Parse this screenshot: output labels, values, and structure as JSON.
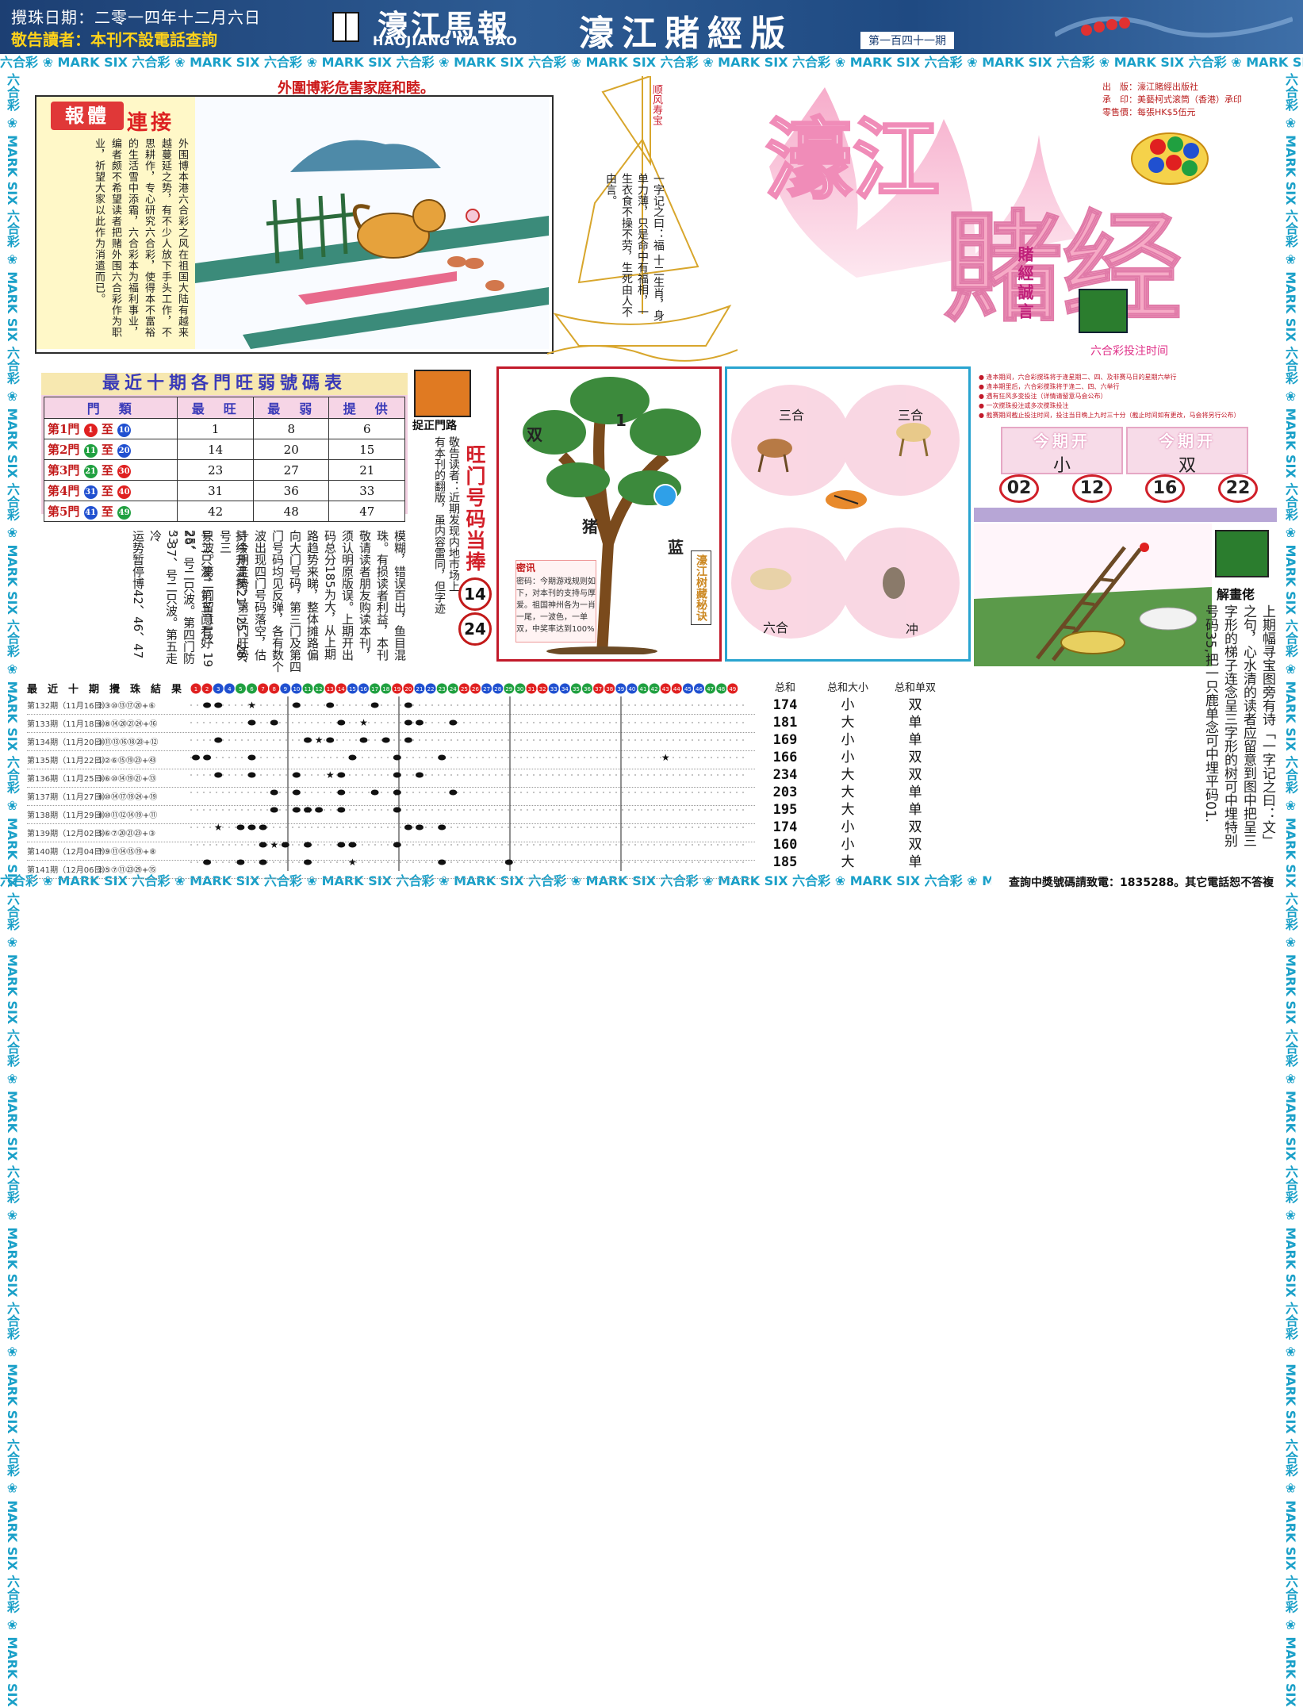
{
  "header": {
    "date_line": "攪珠日期：二零一四年十二月六日",
    "notice": "敬告讀者：本刊不設電話查詢",
    "logo_cn": "濠江馬報",
    "logo_en": "HAOJIANG MA BAO",
    "edition": "濠江賭經版",
    "issue": "第一百四十一期"
  },
  "strip": {
    "unit": "六合彩 ❀ MARK SIX ",
    "text": "六合彩 ❀ MARK SIX 六合彩 ❀ MARK SIX 六合彩 ❀ MARK SIX 六合彩 ❀ MARK SIX 六合彩 ❀ MARK SIX 六合彩 ❀ MARK SIX 六合彩 ❀ MARK SIX 六合彩 ❀ MARK SIX 六合彩 ❀ MARK SIX 六合彩 ❀ MARK SIX 六合彩 ❀ MARK SIX 六合彩 ❀ MARK SIX"
  },
  "dog_section": {
    "headline": "外圍博彩危害家庭和睦。",
    "badge": "報體",
    "badge2": "連接",
    "article": "外围博本港六合彩之风在祖国大陆有越来越蔓延之势，有不少人放下手头工作，不思耕作，专心研究六合彩，使得本不富裕的生活雪中添霜，六合彩本为福利事业，编者颇不希望读者把赌外围六合彩作为职业，祈望大家以此作为消遣而已。"
  },
  "boat": {
    "flag": "顺风寿宝",
    "poem": "一字记之曰：福 十二生肖，身单力薄，只是命中有福相，一生衣食不操不劳，生死由人不由言。"
  },
  "brand": {
    "logo_top": "濠江",
    "logo_bottom": "賭经",
    "motto": "賭經誠言",
    "publisher": "出　版：濠江賭經出版社",
    "printer": "承　印：美藝柯式滚筒（香港）承印",
    "price": "零售價：每張HK$5伍元",
    "bet_time_title": "六合彩投注时间"
  },
  "gate_table": {
    "title": "最近十期各門旺弱號碼表",
    "headers": [
      "門　類",
      "最　旺",
      "最　弱",
      "提　供"
    ],
    "rows": [
      {
        "name": "第1門",
        "from": "1",
        "to": "10",
        "from_color": "red",
        "to_color": "blue",
        "hot": "1",
        "cold": "8",
        "tip": "6"
      },
      {
        "name": "第2門",
        "from": "11",
        "to": "20",
        "from_color": "green",
        "to_color": "blue",
        "hot": "14",
        "cold": "20",
        "tip": "15"
      },
      {
        "name": "第3門",
        "from": "21",
        "to": "30",
        "from_color": "green",
        "to_color": "red",
        "hot": "23",
        "cold": "27",
        "tip": "21"
      },
      {
        "name": "第4門",
        "from": "31",
        "to": "40",
        "from_color": "blue",
        "to_color": "red",
        "hot": "31",
        "cold": "36",
        "tip": "33"
      },
      {
        "name": "第5門",
        "from": "41",
        "to": "49",
        "from_color": "blue",
        "to_color": "green",
        "hot": "42",
        "cold": "48",
        "tip": "47"
      }
    ]
  },
  "zheng_men": {
    "label": "捉正門路",
    "text": "敬告读者：近期发现内地市场上有本刊的翻版，虽内容雷同，但字迹模糊，错误百出，鱼目混珠。有损读者利益，本刊敬请读者朋友购读本刊，须认明原版误。上期开出码总分185为大，从上期路趋势来睇，整体摊路偏向大门号码，第三门及第四门号码均见反弹，各有数个波出现四门号码落空，估计今期走势，第三门旺势持续升温捧21、25、28号只波。第二门留意13、19号二只波，第三门看好25、26号二只波，第四门防33、37号二只波。第五走冷运势暂停博42、46、47",
    "cols": [
      "敬告读者：近期发现内地市场上",
      "有本刊的翻版，虽内容雷同，但字迹",
      "模糊，错误百出，鱼目混",
      "珠。有损读者利益，本刊",
      "敬请读者朋友购读本刊，",
      "须认明原版误。上期开出",
      "码总分185为大，从上期",
      "路趋势来睇，整体摊路偏",
      "向大门号码，第三门及第四",
      "门号码均见反弹，各有数个",
      "波出现四门号码落空，估",
      "计今期走势，第三门旺势",
      "持续升温捧21、25、28、号三",
      "只波。第二门留意13、19",
      "号二只波，第三门看好25、",
      "26、号二只波。第四门防33",
      "、37、号二只波。第五走冷",
      "运势暂停博42、46、47"
    ],
    "hot_title": "旺门号码当捧",
    "hot_numbers": [
      "14",
      "24"
    ]
  },
  "tree": {
    "labels": [
      "双",
      "1",
      "猪",
      "蓝"
    ],
    "note_title": "密讯",
    "note": "密码：今期游戏规则如下，对本刊的支持与厚爱。祖国神州各为一肖一尾，一波色，一单双，中奖率达到100%",
    "side": "濠江树藏秘诀"
  },
  "zodiac": {
    "labels": [
      "三合",
      "三合",
      "六合",
      "冲"
    ],
    "animals": [
      "horse-icon",
      "goat-icon",
      "tiger-icon",
      "pig-icon",
      "monkey-icon"
    ]
  },
  "right_panel": {
    "rules": [
      "● 逢本期间，六合彩搅珠将于逢星期二、四、及非赛马日的星期六举行",
      "● 逢本期里后，六合彩搅珠将于逢二、四、六举行",
      "● 遇有狂风多变投注（详情请留意马会公布）",
      "● 一次搅珠投注或多次搅珠投注",
      "● 截赛期间截止投注时间，投注当日晚上九时三十分（截止时间如有更改，马会将另行公布）"
    ],
    "kai1_title": "今期开",
    "kai1_value": "小",
    "kai2_title": "今期开",
    "kai2_value": "双",
    "numbers": [
      "02",
      "12",
      "16",
      "22"
    ]
  },
  "riddle": {
    "label": "解畫佬",
    "text": "上期幅寻宝图旁有诗「一字记之曰：文」之句，心水清的读者应留意到图中把呈三字形的梯子连念呈三字形的树可中埋特别号码35,把一只鹿单念可中埋平码01."
  },
  "results": {
    "header": "最　近　十　期　攪　珠　結　果",
    "ball_numbers": [
      "1",
      "2",
      "3",
      "4",
      "5",
      "6",
      "7",
      "8",
      "9",
      "10",
      "11",
      "12",
      "13",
      "14",
      "15",
      "16",
      "17",
      "18",
      "19",
      "20",
      "21",
      "22",
      "23",
      "24",
      "25",
      "26",
      "27",
      "28",
      "29",
      "30",
      "31",
      "32",
      "33",
      "34",
      "35",
      "36",
      "37",
      "38",
      "39",
      "40",
      "41",
      "42",
      "43",
      "44",
      "45",
      "46",
      "47",
      "48",
      "49"
    ],
    "rows": [
      {
        "issue": "第132期（11月16日）",
        "nums": "②③⑩⑬⑰⑳+⑥"
      },
      {
        "issue": "第133期（11月18日）",
        "nums": "⑥⑧⑭⑳㉑㉔+⑯"
      },
      {
        "issue": "第134期（11月20日）",
        "nums": "③⑪⑬⑯⑱⑳+⑫"
      },
      {
        "issue": "第135期（11月22日）",
        "nums": "①②⑥⑮⑲㉓+㊸"
      },
      {
        "issue": "第136期（11月25日）",
        "nums": "③⑥⑩⑭⑲㉑+⑬"
      },
      {
        "issue": "第137期（11月27日）",
        "nums": "⑧⑩⑭⑰⑲㉔+⑲"
      },
      {
        "issue": "第138期（11月29日）",
        "nums": "⑧⑩⑪⑫⑭⑲+⑪"
      },
      {
        "issue": "第139期（12月02日）",
        "nums": "⑤⑥⑦⑳㉑㉓+③"
      },
      {
        "issue": "第140期（12月04日）",
        "nums": "⑦⑨⑪⑭⑮⑲+⑧"
      },
      {
        "issue": "第141期（12月06日）",
        "nums": "②⑤⑦⑪㉓㉙+⑮"
      }
    ],
    "sum_title": "总和",
    "sums": [
      "174",
      "181",
      "169",
      "166",
      "234",
      "203",
      "195",
      "174",
      "160",
      "185"
    ],
    "size_title": "总和大小",
    "sizes": [
      "小",
      "大",
      "小",
      "小",
      "大",
      "大",
      "大",
      "小",
      "小",
      "大"
    ],
    "odd_title": "总和单双",
    "odds": [
      "双",
      "单",
      "单",
      "双",
      "双",
      "单",
      "单",
      "双",
      "双",
      "单"
    ],
    "hotline": "查詢中獎號碼請致電：1835288。其它電話恕不答複"
  },
  "colors": {
    "header_blue": "#1c3f73",
    "accent_red": "#c21a1a",
    "strip_blue": "#1aa0c8",
    "logo_pink": "#f08cb8",
    "zodiac_blue": "#29a4d0"
  }
}
